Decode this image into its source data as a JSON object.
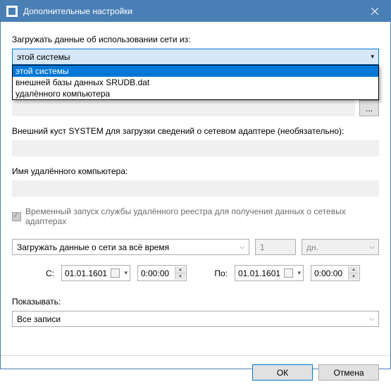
{
  "window": {
    "title": "Дополнительные настройки"
  },
  "source": {
    "label": "Загружать данные об использовании сети из:",
    "value": "этой системы",
    "options": [
      "этой системы",
      "внешней базы данных SRUDB.dat",
      "удалённого компьютера"
    ]
  },
  "browse": {
    "label": "..."
  },
  "hive": {
    "label": "Внешний куст SYSTEM для загрузки сведений о сетевом адаптере (необязательно):"
  },
  "remote": {
    "label": "Имя удалённого компьютера:"
  },
  "tempService": {
    "label": "Временный запуск службы удалённого реестра для получения данных о сетевых адаптерах"
  },
  "period": {
    "mode": "Загружать данные о сети за всё время",
    "count": "1",
    "unit": "дн."
  },
  "range": {
    "fromLabel": "С:",
    "toLabel": "По:",
    "fromDate": "01.01.1601",
    "fromTime": "0:00:00",
    "toDate": "01.01.1601",
    "toTime": "0:00:00"
  },
  "show": {
    "label": "Показывать:",
    "value": "Все записи"
  },
  "buttons": {
    "ok": "ОК",
    "cancel": "Отмена"
  }
}
